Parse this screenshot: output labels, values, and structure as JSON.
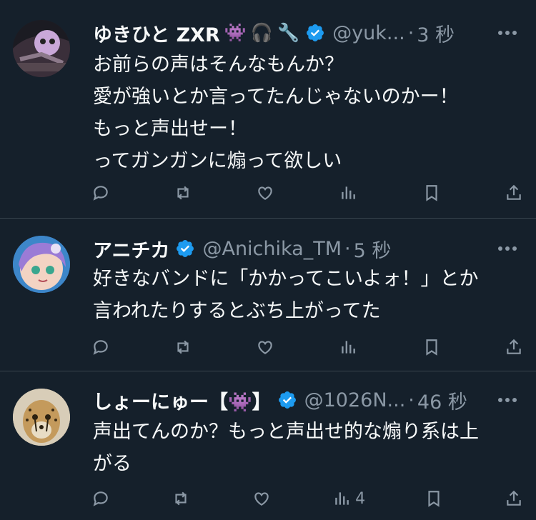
{
  "tweets": [
    {
      "name": "ゆきひと ZXR",
      "emojis": [
        "👾",
        "🎧",
        "🔧"
      ],
      "handle": "@yuk...",
      "time": "3 秒",
      "lines": [
        "お前らの声はそんなもんか？",
        "愛が強いとか言ってたんじゃないのかー！",
        "もっと声出せー！",
        "ってガンガンに煽って欲しい"
      ],
      "analytics_count": ""
    },
    {
      "name": "アニチカ",
      "emojis": [],
      "handle": "@Anichika_TM",
      "time": "5 秒",
      "lines": [
        "好きなバンドに「かかってこいよォ！」とか",
        "言われたりするとぶち上がってた"
      ],
      "analytics_count": ""
    },
    {
      "name": "しょーにゅー【👾】",
      "emojis": [],
      "handle": "@1026N...",
      "time": "46 秒",
      "lines": [
        "声出てんのか？もっと声出せ的な煽り系は上",
        "がる"
      ],
      "analytics_count": "4"
    }
  ],
  "separator": "·",
  "colors": {
    "background": "#15202b",
    "text": "#f7f9f9",
    "muted": "#8b98a5",
    "verified": "#1d9bf0",
    "divider": "#38444d"
  }
}
